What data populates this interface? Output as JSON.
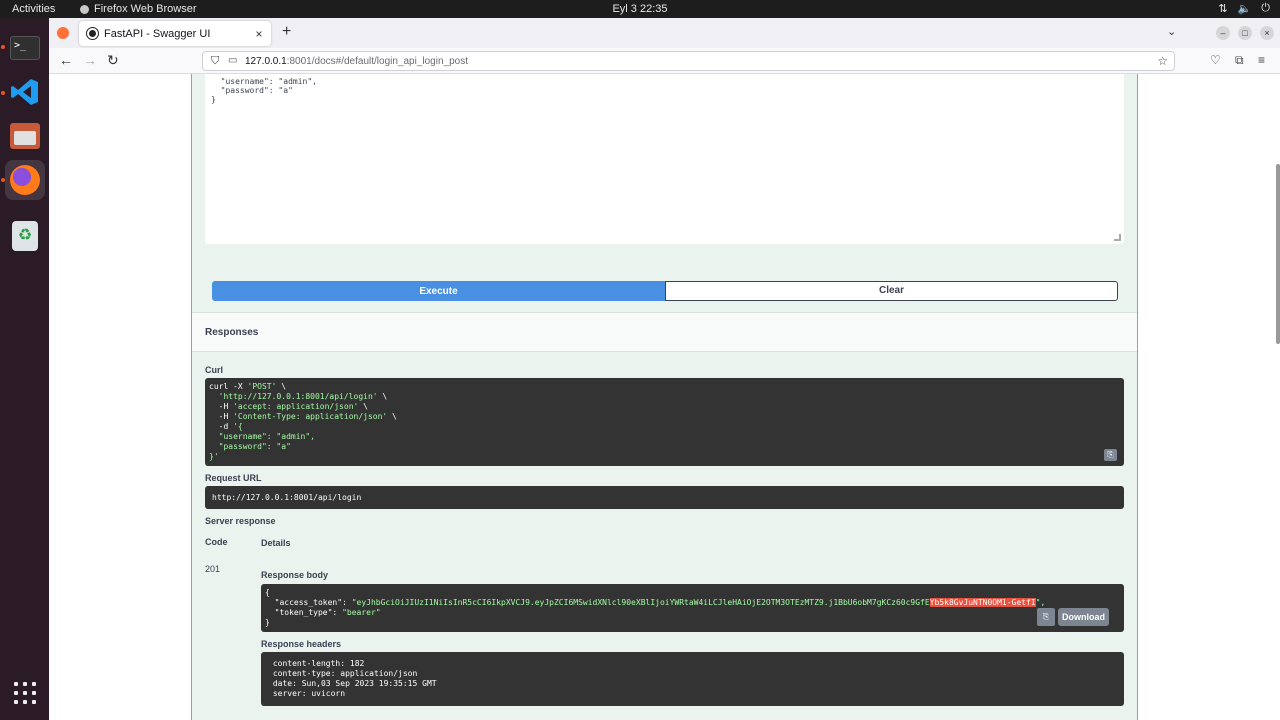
{
  "topbar": {
    "activities": "Activities",
    "app_name": "Firefox Web Browser",
    "clock": "Eyl 3  22:35",
    "sys_icons": [
      "network-icon",
      "volume-icon",
      "power-icon"
    ]
  },
  "dock": {
    "items": [
      "terminal-icon",
      "vscode-icon",
      "files-icon",
      "firefox-icon",
      "trash-icon"
    ],
    "apps_icon": "show-apps-icon"
  },
  "browser": {
    "tab_title": "FastAPI - Swagger UI",
    "close_glyph": "×",
    "new_tab_glyph": "+",
    "url_host": "127.0.0.1",
    "url_path": ":8001/docs#/default/login_api_login_post"
  },
  "page": {
    "request_body_text": "  \"username\": \"admin\",\n  \"password\": \"a\"\n}",
    "execute_label": "Execute",
    "clear_label": "Clear",
    "responses_title": "Responses",
    "curl_label": "Curl",
    "curl_line1": "curl -X ",
    "curl_line1_s": "'POST'",
    "curl_line1_end": " \\",
    "curl_line2": "  ",
    "curl_line2_s": "'http://127.0.0.1:8001/api/login'",
    "curl_line2_end": " \\",
    "curl_line3": "  -H ",
    "curl_line3_s": "'accept: application/json'",
    "curl_line3_end": " \\",
    "curl_line4": "  -H ",
    "curl_line4_s": "'Content-Type: application/json'",
    "curl_line4_end": " \\",
    "curl_line5": "  -d ",
    "curl_line5_s": "'{",
    "curl_line6": "  \"username\": \"admin\",",
    "curl_line7": "  \"password\": \"a\"",
    "curl_line8": "}'",
    "request_url_label": "Request URL",
    "request_url": "http://127.0.0.1:8001/api/login",
    "server_response_label": "Server response",
    "code_header": "Code",
    "details_header": "Details",
    "status_code": "201",
    "response_body_label": "Response body",
    "body_open": "{",
    "body_token_key": "  \"access_token\": ",
    "body_token_val": "\"eyJhbGciOiJIUzI1NiIsInR5cCI6IkpXVCJ9.eyJpZCI6MSwidXNlcl90eXBlIjoiYWRtaW4iLCJleHAiOjE2OTM3OTEzMTZ9.j1BbU6obM7gKCz60c9GfE",
    "body_token_hl": "Yb5k8GvJuNTN0OM1-GetfI",
    "body_token_end": "\",",
    "body_type_key": "  \"token_type\": ",
    "body_type_val": "\"bearer\"",
    "body_close": "}",
    "download_label": "Download",
    "response_headers_label": "Response headers",
    "headers": [
      " content-length: 182",
      " content-type: application/json",
      " date: Sun,03 Sep 2023 19:35:15 GMT",
      " server: uvicorn"
    ]
  }
}
